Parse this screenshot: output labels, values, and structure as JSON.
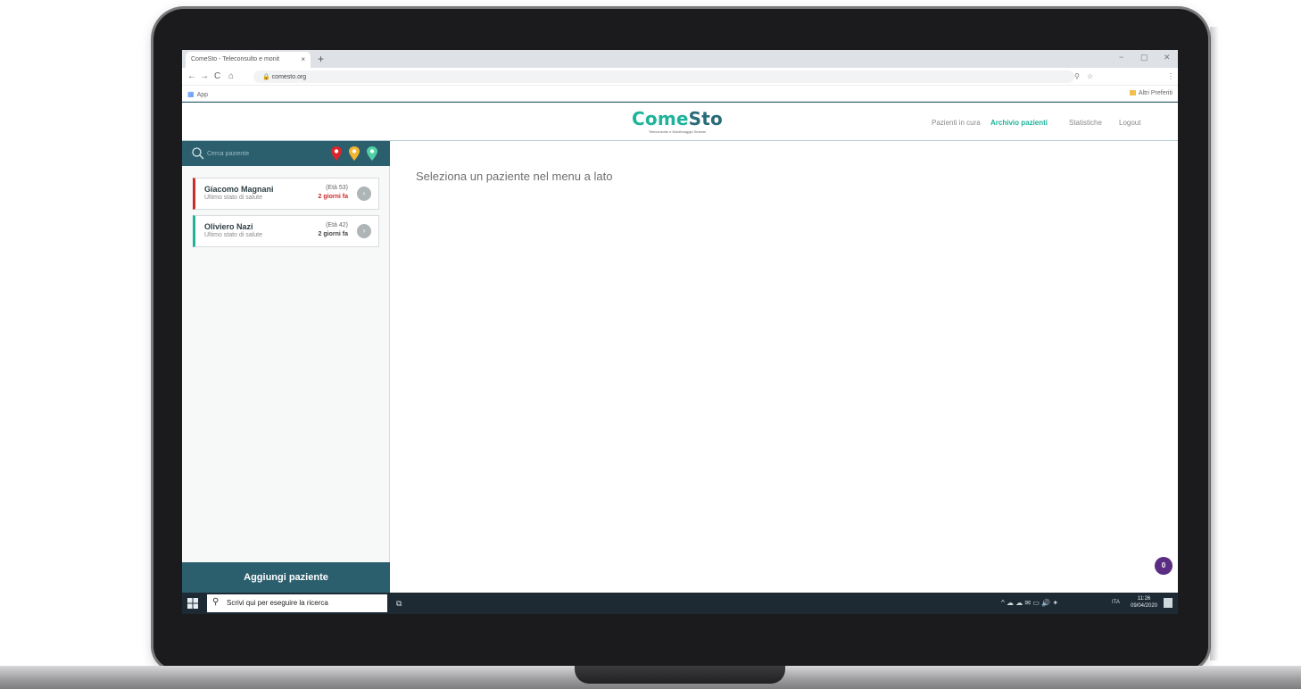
{
  "browser": {
    "tab_title": "ComeSto - Teleconsulto e monit",
    "tab_close": "×",
    "new_tab": "+",
    "nav_back": "←",
    "nav_forward": "→",
    "nav_reload": "C",
    "nav_home": "⌂",
    "url": "comesto.org",
    "bookmarks_app": "App",
    "bookmarks_other": "Altri Preferiti",
    "win_minimize": "−",
    "win_restore": "▢",
    "win_close": "✕"
  },
  "header": {
    "logo_come": "Come",
    "logo_sto": "Sto",
    "logo_subtitle": "Teleconsulto e Monitoraggio Sintomi",
    "nav": [
      {
        "label": "Pazienti in cura",
        "active": false
      },
      {
        "label": "Archivio pazienti",
        "active": true
      },
      {
        "label": "Statistiche",
        "active": false
      },
      {
        "label": "Logout",
        "active": false
      }
    ]
  },
  "sidebar": {
    "search_placeholder": "Cerca paziente",
    "filter_pins": [
      {
        "name": "red",
        "color": "#d9262c"
      },
      {
        "name": "yellow",
        "color": "#f2b531"
      },
      {
        "name": "green",
        "color": "#4fd1a4"
      }
    ],
    "patients": [
      {
        "name": "Giacomo Magnani",
        "subtitle": "Ultimo stato di salute",
        "age": "(Età 53)",
        "last_update": "2 giorni fa",
        "status": "alert"
      },
      {
        "name": "Oliviero Nazi",
        "subtitle": "Ultimo stato di salute",
        "age": "(Età 42)",
        "last_update": "2 giorni fa",
        "status": "ok"
      }
    ],
    "add_patient_label": "Aggiungi paziente"
  },
  "main": {
    "message": "Seleziona un paziente nel menu a lato",
    "chat_badge_count": "0"
  },
  "taskbar": {
    "search_text": "Scrivi qui per eseguire la ricerca",
    "language": "ITA",
    "time": "11:26",
    "date": "09/04/2020"
  },
  "colors": {
    "brand_teal": "#1fb39b",
    "brand_dark": "#2c5f6e",
    "alert_red": "#cc2b2b",
    "badge_purple": "#5b2d82"
  }
}
